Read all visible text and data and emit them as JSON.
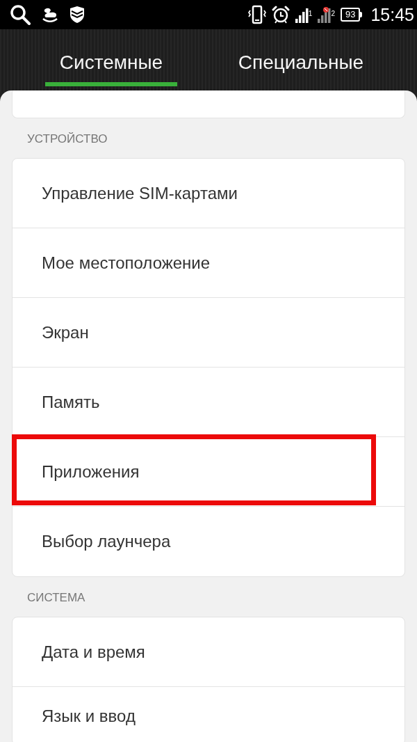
{
  "status_bar": {
    "sims": [
      {
        "label": "1",
        "no_signal": false
      },
      {
        "label": "2",
        "no_signal": true
      }
    ],
    "battery": "93",
    "time": "15:45"
  },
  "tabs": [
    {
      "label": "Системные",
      "selected": true
    },
    {
      "label": "Специальные",
      "selected": false
    }
  ],
  "sections": [
    {
      "header": "УСТРОЙСТВО",
      "items": [
        {
          "label": "Управление SIM-картами",
          "highlighted": false
        },
        {
          "label": "Мое местоположение",
          "highlighted": false
        },
        {
          "label": "Экран",
          "highlighted": false
        },
        {
          "label": "Память",
          "highlighted": false
        },
        {
          "label": "Приложения",
          "highlighted": true
        },
        {
          "label": "Выбор лаунчера",
          "highlighted": false
        }
      ]
    },
    {
      "header": "СИСТЕМА",
      "items": [
        {
          "label": "Дата и время",
          "highlighted": false
        },
        {
          "label": "Язык и ввод",
          "highlighted": false
        }
      ]
    }
  ]
}
